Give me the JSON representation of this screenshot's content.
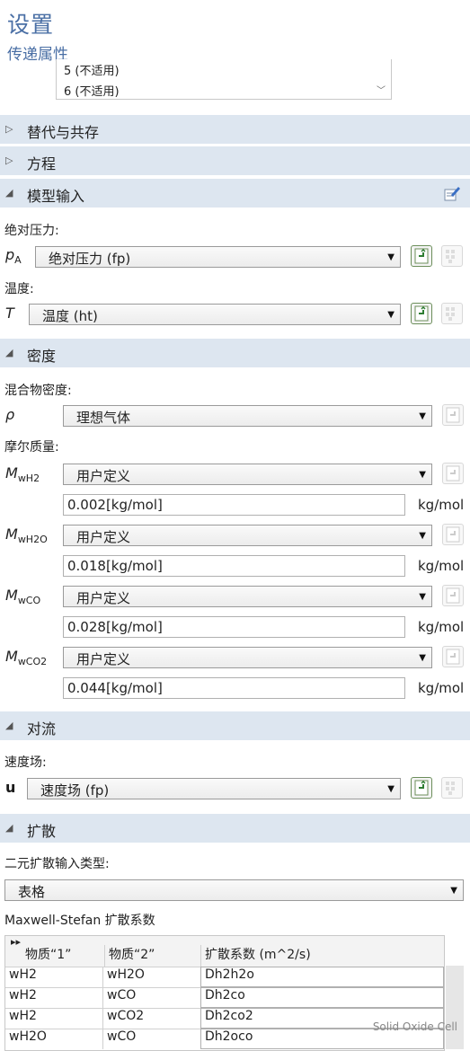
{
  "window": {
    "title": "设置",
    "subtitle": "传递属性"
  },
  "listbox": {
    "items": [
      "5 (不适用)",
      "6 (不适用)"
    ]
  },
  "sections": {
    "substitution": "替代与共存",
    "equation": "方程",
    "model_input": "模型输入",
    "density": "密度",
    "convection": "对流",
    "diffusion": "扩散"
  },
  "model_input": {
    "abs_pressure_label": "绝对压力:",
    "abs_pressure_symbol": "p",
    "abs_pressure_sub": "A",
    "abs_pressure_value": "绝对压力 (fp)",
    "temperature_label": "温度:",
    "temperature_symbol": "T",
    "temperature_value": "温度 (ht)"
  },
  "density": {
    "mixture_label": "混合物密度:",
    "mixture_symbol": "ρ",
    "mixture_value": "理想气体",
    "molar_mass_label": "摩尔质量:",
    "species": [
      {
        "symbol": "M",
        "sub": "wH2",
        "method": "用户定义",
        "value": "0.002[kg/mol]",
        "unit": "kg/mol"
      },
      {
        "symbol": "M",
        "sub": "wH2O",
        "method": "用户定义",
        "value": "0.018[kg/mol]",
        "unit": "kg/mol"
      },
      {
        "symbol": "M",
        "sub": "wCO",
        "method": "用户定义",
        "value": "0.028[kg/mol]",
        "unit": "kg/mol"
      },
      {
        "symbol": "M",
        "sub": "wCO2",
        "method": "用户定义",
        "value": "0.044[kg/mol]",
        "unit": "kg/mol"
      }
    ]
  },
  "convection": {
    "velocity_label": "速度场:",
    "velocity_symbol": "u",
    "velocity_value": "速度场 (fp)"
  },
  "diffusion": {
    "input_type_label": "二元扩散输入类型:",
    "input_type_value": "表格",
    "table_title": "Maxwell-Stefan 扩散系数",
    "table_expand": "▸▸",
    "columns": [
      "物质“1”",
      "物质“2”",
      "扩散系数 (m^2/s)"
    ],
    "rows": [
      [
        "wH2",
        "wH2O",
        "Dh2h2o"
      ],
      [
        "wH2",
        "wCO",
        "Dh2co"
      ],
      [
        "wH2",
        "wCO2",
        "Dh2co2"
      ],
      [
        "wH2O",
        "wCO",
        "Dh2oco"
      ]
    ]
  },
  "watermark": "Solid Oxide Cell",
  "icons": {
    "collapsed": "triangle-right-icon",
    "expanded": "triangle-down-icon",
    "edit": "edit-pencil-icon",
    "goto": "goto-source-icon",
    "plot": "plot-grid-icon",
    "dropdown": "chevron-down-icon"
  },
  "colors": {
    "title": "#4a6fa5",
    "section_bg": "#dde6f0",
    "button_accent": "#6b8e5a"
  }
}
